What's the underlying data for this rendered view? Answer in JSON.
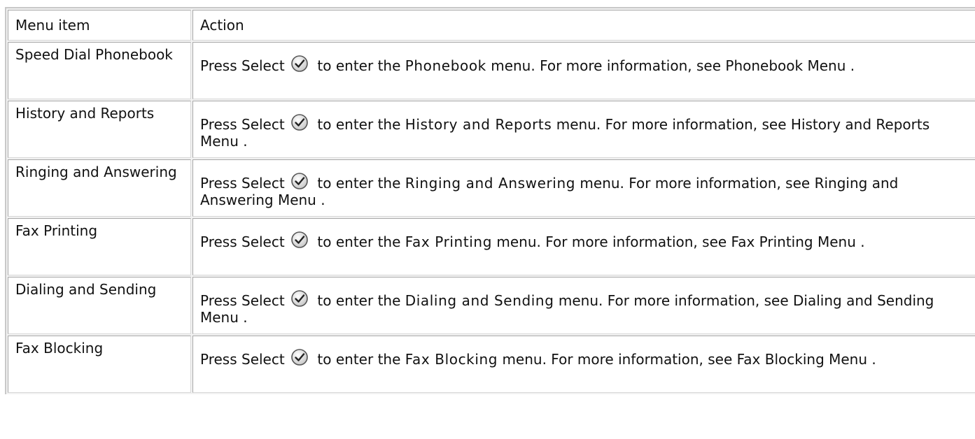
{
  "table": {
    "headers": [
      "Menu item",
      "Action"
    ],
    "icon": "select-check-icon",
    "rows": [
      {
        "item": "Speed Dial Phonebook",
        "action_prefix": "Press Select",
        "action_mid": "to enter the",
        "menu_name": "Phonebook",
        "action_suffix": "menu. For more information, see",
        "link": "Phonebook Menu",
        "end": "."
      },
      {
        "item": "History and Reports",
        "action_prefix": "Press Select",
        "action_mid": "to enter the",
        "menu_name": "History and Reports",
        "action_suffix": "menu. For more information, see",
        "link": "History and Reports Menu",
        "end": "."
      },
      {
        "item": "Ringing and Answering",
        "action_prefix": "Press Select",
        "action_mid": "to enter the",
        "menu_name": "Ringing and Answering",
        "action_suffix": "menu. For more information, see",
        "link": "Ringing and Answering Menu",
        "end": "."
      },
      {
        "item": "Fax Printing",
        "action_prefix": "Press Select",
        "action_mid": "to enter the",
        "menu_name": "Fax Printing",
        "action_suffix": "menu. For more information, see",
        "link": "Fax Printing Menu",
        "end": "."
      },
      {
        "item": "Dialing and Sending",
        "action_prefix": "Press Select",
        "action_mid": "to enter the",
        "menu_name": "Dialing and Sending",
        "action_suffix": "menu. For more information, see",
        "link": "Dialing and Sending Menu",
        "end": "."
      },
      {
        "item": "Fax Blocking",
        "action_prefix": "Press Select",
        "action_mid": "to enter the",
        "menu_name": "Fax Blocking",
        "action_suffix": "menu. For more information, see",
        "link": "Fax Blocking Menu",
        "end": "."
      }
    ]
  }
}
